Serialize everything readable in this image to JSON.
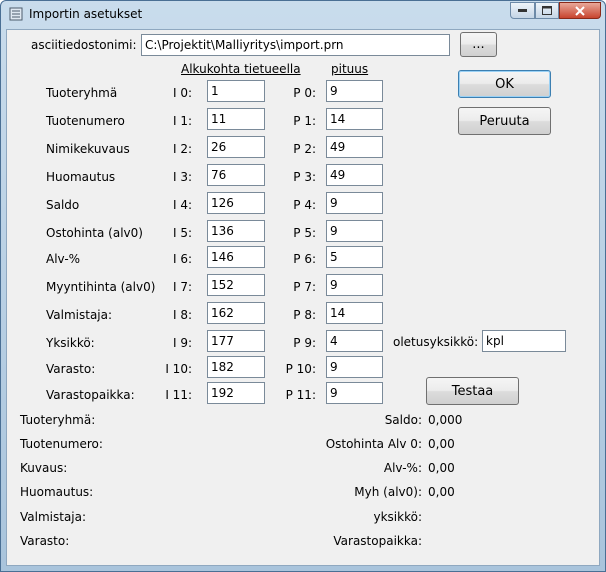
{
  "window": {
    "title": "Importin asetukset",
    "icon": "app-icon"
  },
  "file": {
    "label": "asciitiedostonimi:",
    "value": "C:\\Projektit\\Malliyritys\\import.prn",
    "browse_label": "..."
  },
  "headers": {
    "start": "Alkukohta tietueella",
    "length": "pituus"
  },
  "fields": [
    {
      "name": "Tuoteryhmä",
      "start_label": "I 0:",
      "start": "1",
      "length_label": "P 0:",
      "length": "9"
    },
    {
      "name": "Tuotenumero",
      "start_label": "I 1:",
      "start": "11",
      "length_label": "P 1:",
      "length": "14"
    },
    {
      "name": "Nimikekuvaus",
      "start_label": "I 2:",
      "start": "26",
      "length_label": "P 2:",
      "length": "49"
    },
    {
      "name": "Huomautus",
      "start_label": "I 3:",
      "start": "76",
      "length_label": "P 3:",
      "length": "49"
    },
    {
      "name": "Saldo",
      "start_label": "I 4:",
      "start": "126",
      "length_label": "P 4:",
      "length": "9"
    },
    {
      "name": "Ostohinta (alv0)",
      "start_label": "I 5:",
      "start": "136",
      "length_label": "P 5:",
      "length": "9"
    },
    {
      "name": "Alv-%",
      "start_label": "I 6:",
      "start": "146",
      "length_label": "P 6:",
      "length": "5"
    },
    {
      "name": "Myyntihinta (alv0)",
      "start_label": "I 7:",
      "start": "152",
      "length_label": "P 7:",
      "length": "9"
    },
    {
      "name": "Valmistaja:",
      "start_label": "I 8:",
      "start": "162",
      "length_label": "P 8:",
      "length": "14"
    },
    {
      "name": "Yksikkö:",
      "start_label": "I 9:",
      "start": "177",
      "length_label": "P 9:",
      "length": "4"
    },
    {
      "name": "Varasto:",
      "start_label": "I 10:",
      "start": "182",
      "length_label": "P 10:",
      "length": "9"
    },
    {
      "name": "Varastopaikka:",
      "start_label": "I 11:",
      "start": "192",
      "length_label": "P 11:",
      "length": "9"
    }
  ],
  "default_unit": {
    "label": "oletusyksikkö:",
    "value": "kpl"
  },
  "buttons": {
    "ok": "OK",
    "cancel": "Peruuta",
    "test": "Testaa"
  },
  "preview_left": [
    {
      "label": "Tuoteryhmä:",
      "value": ""
    },
    {
      "label": "Tuotenumero:",
      "value": ""
    },
    {
      "label": "Kuvaus:",
      "value": ""
    },
    {
      "label": "Huomautus:",
      "value": ""
    },
    {
      "label": "Valmistaja:",
      "value": ""
    },
    {
      "label": "Varasto:",
      "value": ""
    }
  ],
  "preview_right": [
    {
      "label": "Saldo:",
      "value": "0,000"
    },
    {
      "label": "Ostohinta Alv 0:",
      "value": "0,00"
    },
    {
      "label": "Alv-%:",
      "value": "0,00"
    },
    {
      "label": "Myh (alv0):",
      "value": "0,00"
    },
    {
      "label": "yksikkö:",
      "value": ""
    },
    {
      "label": "Varastopaikka:",
      "value": ""
    }
  ]
}
